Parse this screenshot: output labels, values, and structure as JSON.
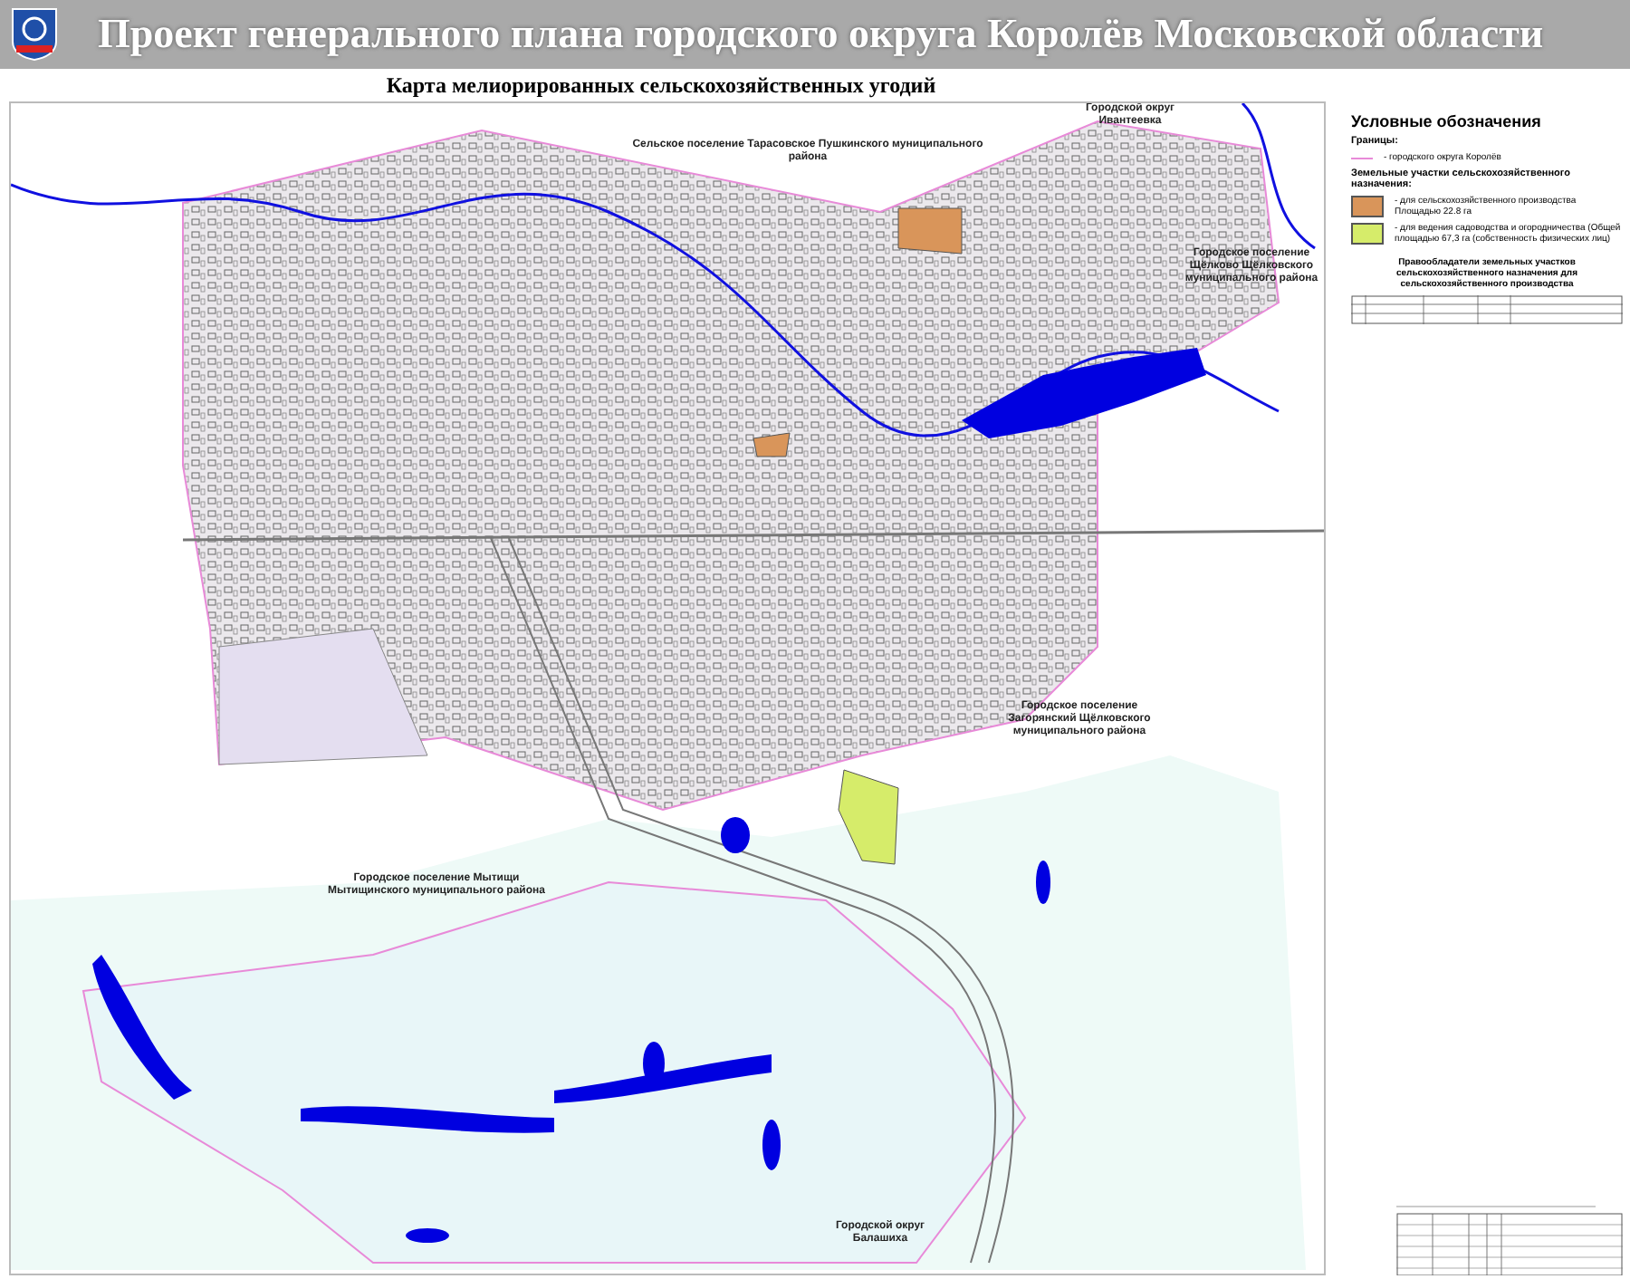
{
  "header": {
    "title": "Проект генерального плана городского округа Королёв Московской области"
  },
  "subtitle": "Карта мелиорированных сельскохозяйственных угодий",
  "map": {
    "labels": [
      {
        "text": "Сельское поселение Тарасовское Пушкинского муниципального района"
      },
      {
        "text": "Городской округ Ивантеевка"
      },
      {
        "text": "Городское поселение Щёлково Щёлковского муниципального района"
      },
      {
        "text": "Городское поселение Загорянский Щёлковского муниципального района"
      },
      {
        "text": "Городское поселение Мытищи Мытищинского муниципального района"
      },
      {
        "text": "Городской округ Балашиха"
      }
    ]
  },
  "legend": {
    "title": "Условные обозначения",
    "boundaries_heading": "Границы:",
    "boundary_item": "- городского округа Королёв",
    "land_heading": "Земельные участки сельскохозяйственного назначения:",
    "land_items": [
      {
        "text": "- для сельскохозяйственного производства Площадью 22.8 га",
        "color": "#d9955a"
      },
      {
        "text": "- для ведения садоводства и огородничества (Общей площадью 67,3 га (собственность физических лиц)",
        "color": "#d6ec6a"
      }
    ],
    "owners_heading": "Правообладатели земельных участков сельскохозяйственного назначения для сельскохозяйственного производства"
  }
}
